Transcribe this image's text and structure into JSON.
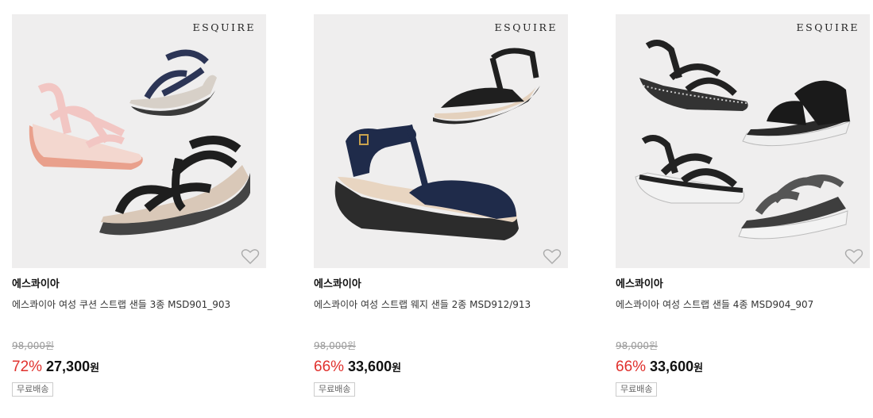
{
  "products": [
    {
      "logo": "ESQUIRE",
      "brand": "에스콰이아",
      "title": "에스콰이아 여성 쿠션 스트랩 샌들 3종 MSD901_903",
      "original_price": "98,000원",
      "discount_rate": "72%",
      "price": "27,300",
      "currency": "원",
      "shipping_badge": "무료배송",
      "wishlist_icon": "heart-outline-icon"
    },
    {
      "logo": "ESQUIRE",
      "brand": "에스콰이아",
      "title": "에스콰이아 여성 스트랩 웨지 샌들 2종 MSD912/913",
      "original_price": "98,000원",
      "discount_rate": "66%",
      "price": "33,600",
      "currency": "원",
      "shipping_badge": "무료배송",
      "wishlist_icon": "heart-outline-icon"
    },
    {
      "logo": "ESQUIRE",
      "brand": "에스콰이아",
      "title": "에스콰이아 여성 스트랩 샌들 4종 MSD904_907",
      "original_price": "98,000원",
      "discount_rate": "66%",
      "price": "33,600",
      "currency": "원",
      "shipping_badge": "무료배송",
      "wishlist_icon": "heart-outline-icon"
    }
  ],
  "colors": {
    "discount": "#e0312d",
    "image_bg": "#efeeee",
    "strike": "#999999"
  }
}
